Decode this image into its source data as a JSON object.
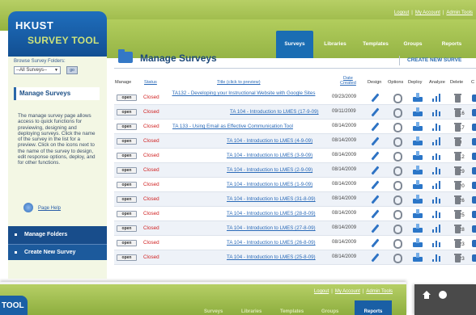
{
  "header": {
    "links": [
      "Logout",
      "My Account",
      "Admin Tools"
    ],
    "separator": "|"
  },
  "logo": {
    "line1": "HKUST",
    "line2": "SURVEY TOOL"
  },
  "nav": {
    "tabs": [
      {
        "label": "Surveys",
        "active": true
      },
      {
        "label": "Libraries",
        "active": false
      },
      {
        "label": "Templates",
        "active": false
      },
      {
        "label": "Groups",
        "active": false
      },
      {
        "label": "Reports",
        "active": false
      }
    ]
  },
  "sidebar": {
    "browse_label": "Browse Survey Folders:",
    "folder_select": "--All Surveys--",
    "go_label": "go",
    "heading": "Manage Surveys",
    "description": "The manage survey page allows access to quick functions for previewing, designing and deploying surveys. Click the name of the survey in the list for a preview. Click on the icons next to the name of the survey to design, edit response options, deploy, and for other functions.",
    "help_link": "Page Help",
    "manage_folders": "Manage Folders",
    "create_new_survey": "Create New Survey"
  },
  "main": {
    "title": "Manage Surveys",
    "create_link": "CREATE NEW SURVE",
    "columns": {
      "manage": "Manage",
      "status": "Status",
      "title": "Title (click to preview)",
      "date_l1": "Date",
      "date_l2": "Created",
      "design": "Design",
      "options": "Options",
      "deploy": "Deploy",
      "analyze": "Analyze",
      "delete": "Delete",
      "more": "C"
    },
    "rows": [
      {
        "open": "open",
        "status": "Closed",
        "title": "TA132 - Developing your Instructional Website with Google Sites",
        "date": "09/23/2009",
        "count": ""
      },
      {
        "open": "open",
        "status": "Closed",
        "title": "TA 104 - Introduction to LMES (17-9-09)",
        "date": "09/11/2009",
        "count": "16"
      },
      {
        "open": "open",
        "status": "Closed",
        "title": "TA 133 - Using Email as Effective Communication Tool",
        "date": "08/14/2009",
        "count": "17"
      },
      {
        "open": "open",
        "status": "Closed",
        "title": "TA 104 - Introduction to LMES (4-9-09)",
        "date": "08/14/2009",
        "count": "9"
      },
      {
        "open": "open",
        "status": "Closed",
        "title": "TA 104 - Introduction to LMES (3-9-09)",
        "date": "08/14/2009",
        "count": "12"
      },
      {
        "open": "open",
        "status": "Closed",
        "title": "TA 104 - Introduction to LMES (2-9-09)",
        "date": "08/14/2009",
        "count": "29"
      },
      {
        "open": "open",
        "status": "Closed",
        "title": "TA 104 - Introduction to LMES (1-9-09)",
        "date": "08/14/2009",
        "count": "20"
      },
      {
        "open": "open",
        "status": "Closed",
        "title": "TA 104 - Introduction to LMES (31-8-09)",
        "date": "08/14/2009",
        "count": "26"
      },
      {
        "open": "open",
        "status": "Closed",
        "title": "TA 104 - Introduction to LMES (28-8-09)",
        "date": "08/14/2009",
        "count": "25"
      },
      {
        "open": "open",
        "status": "Closed",
        "title": "TA 104 - Introduction to LMES (27-8-09)",
        "date": "08/14/2009",
        "count": "28"
      },
      {
        "open": "open",
        "status": "Closed",
        "title": "TA 104 - Introduction to LMES (26-8-09)",
        "date": "08/14/2009",
        "count": "23"
      },
      {
        "open": "open",
        "status": "Closed",
        "title": "TA 104 - Introduction to LMES (25-8-09)",
        "date": "08/14/2009",
        "count": "23"
      }
    ]
  },
  "second_window": {
    "logo_fragment": "TOOL",
    "links": [
      "Logout",
      "My Account",
      "Admin Tools"
    ],
    "tabs": [
      "Surveys",
      "Libraries",
      "Templates",
      "Groups",
      "Reports"
    ],
    "active_tab": "Reports"
  },
  "colors": {
    "brand_green": "#a8c552",
    "brand_blue": "#1a5fa5",
    "status_red": "#d12424",
    "link_blue": "#2a6ab8"
  },
  "icons": {
    "design": "pencil-icon",
    "options": "gear-icon",
    "deploy": "tray-icon",
    "analyze": "bar-chart-icon",
    "delete": "trash-icon",
    "copy": "clip-icon"
  }
}
